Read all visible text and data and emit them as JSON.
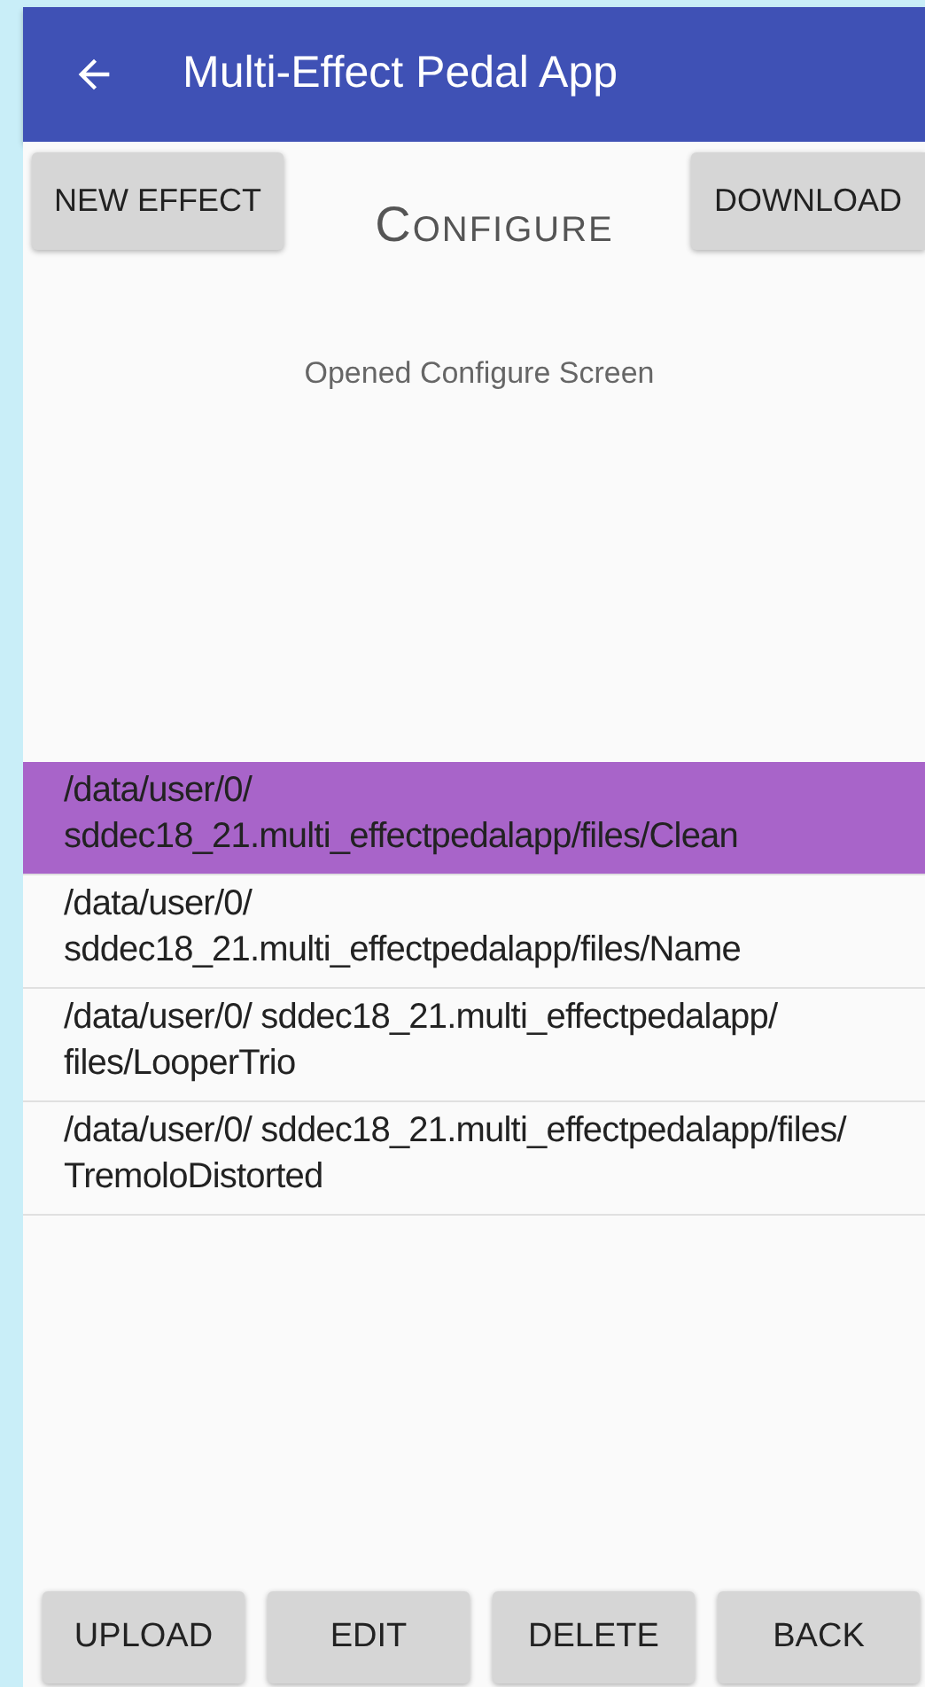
{
  "app_bar": {
    "title": "Multi-Effect Pedal App"
  },
  "top_buttons": [
    "NEW EFFECT",
    "DOWNLOAD"
  ],
  "heading": "Configure",
  "status": "Opened Configure Screen",
  "files": [
    {
      "path": "/data/user/0/ sddec18_21.multi_effectpedalapp/files/Clean",
      "selected": true
    },
    {
      "path": "/data/user/0/ sddec18_21.multi_effectpedalapp/files/Name",
      "selected": false
    },
    {
      "path": "/data/user/0/ sddec18_21.multi_effectpedalapp/ files/LooperTrio",
      "selected": false
    },
    {
      "path": "/data/user/0/ sddec18_21.multi_effectpedalapp/files/ TremoloDistorted",
      "selected": false
    }
  ],
  "bottom_buttons": [
    "UPLOAD",
    "EDIT",
    "DELETE",
    "BACK"
  ]
}
